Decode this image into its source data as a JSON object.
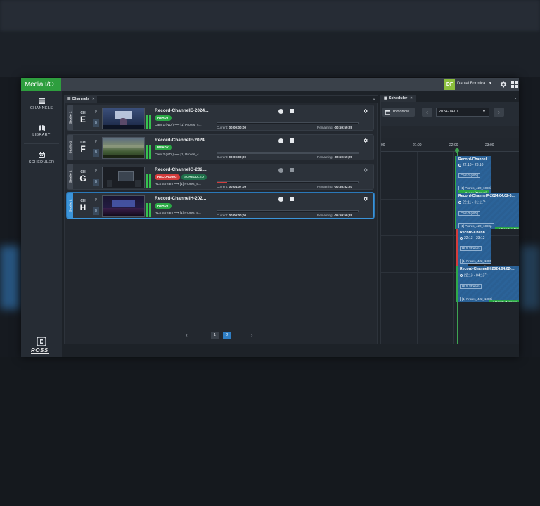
{
  "app": {
    "logo": "Media I/O",
    "user_initials": "DF",
    "user_name": "Daniel Formica",
    "brand": "ROSS"
  },
  "sidebar": {
    "items": [
      {
        "label": "CHANNELS",
        "icon": "list-icon"
      },
      {
        "label": "LIBRARY",
        "icon": "library-icon"
      },
      {
        "label": "SCHEDULER",
        "icon": "calendar-icon"
      }
    ]
  },
  "channels_panel": {
    "tab_label": "Channels",
    "tab_close": "×",
    "cards": [
      {
        "studio": "Studio 1",
        "ch": "CH",
        "letter": "E",
        "name": "Record-ChannelE-2024...",
        "badges": [
          "READY"
        ],
        "source": "Cam 1 (NDI)",
        "dest": "[1] Prores_4...",
        "current_label": "Current:",
        "current": "00:00:00;00",
        "remaining_label": "Remaining:",
        "remaining": "-00:59:59;29",
        "progress": 0,
        "controls_enabled": true
      },
      {
        "studio": "Studio 1",
        "ch": "CH",
        "letter": "F",
        "name": "Record-ChannelF-2024...",
        "badges": [
          "READY"
        ],
        "source": "Cam 2 (NDI)",
        "dest": "[1] Prores_4...",
        "current_label": "Current:",
        "current": "00:00:00;00",
        "remaining_label": "Remaining:",
        "remaining": "-02:59:59;29",
        "progress": 0,
        "controls_enabled": true
      },
      {
        "studio": "Studio 2",
        "ch": "CH",
        "letter": "G",
        "name": "Record-ChannelG-202...",
        "badges": [
          "RECORDING",
          "SCHEDULED"
        ],
        "source": "HLS Stream",
        "dest": "[1] Prores_4...",
        "current_label": "Current:",
        "current": "00:04:07;09",
        "remaining_label": "Remaining:",
        "remaining": "-00:55:52;20",
        "progress": 0.069,
        "controls_enabled": false
      },
      {
        "studio": "Studio 2",
        "ch": "CH",
        "letter": "H",
        "name": "Record-ChannelH-202...",
        "badges": [
          "READY"
        ],
        "source": "HLS Stream",
        "dest": "[1] Prores_4...",
        "current_label": "Current:",
        "current": "00:00:00;00",
        "remaining_label": "Remaining:",
        "remaining": "-05:59:59;29",
        "progress": 0,
        "controls_enabled": true,
        "selected": true
      }
    ],
    "pagination": {
      "prev": "‹",
      "pages": [
        "1",
        "2"
      ],
      "current_page": "2",
      "next": "›"
    }
  },
  "scheduler_panel": {
    "tab_label": "Scheduler",
    "tab_close": "×",
    "tomorrow_label": "Tomorrow",
    "date_value": "2024-04-01",
    "prev": "‹",
    "next": "›",
    "ruler_ticks": [
      "00",
      "21:00",
      "22:00",
      "23:00"
    ],
    "events": [
      {
        "title": "Record-Channel...",
        "time": "22:10 - 23:10",
        "tags": [
          "Cam 1 (NDI)",
          "[1] Prores_422_1080i"
        ],
        "status": "Ready (Manual)",
        "status_type": "ready"
      },
      {
        "title": "Record-ChannelF-2024.04.02-0...",
        "time": "22:11 - 01:11",
        "time_sup": "+1",
        "tags": [
          "Cam 2 (NDI)",
          "[1] Prores_422_1080p"
        ],
        "status": "Ready (Manual)",
        "status_type": "ready"
      },
      {
        "title": "Record-Chann...",
        "time": "22:13 - 23:12",
        "tags": [
          "HLS Stream",
          "[1] Prores_422_1080i"
        ],
        "status": "Recording",
        "status_type": "recording"
      },
      {
        "title": "Record-ChannelH-2024.04.02-...",
        "time": "22:13 - 04:13",
        "time_sup": "+1",
        "tags": [
          "HLS Stream",
          "[1] Prores_422_1080i"
        ],
        "status": "Ready (Manual)",
        "status_type": "ready"
      }
    ]
  },
  "colors": {
    "accent_green": "#2e9e3e",
    "ready": "#2aa845",
    "recording": "#d33c3c",
    "selected": "#3b94d9"
  }
}
